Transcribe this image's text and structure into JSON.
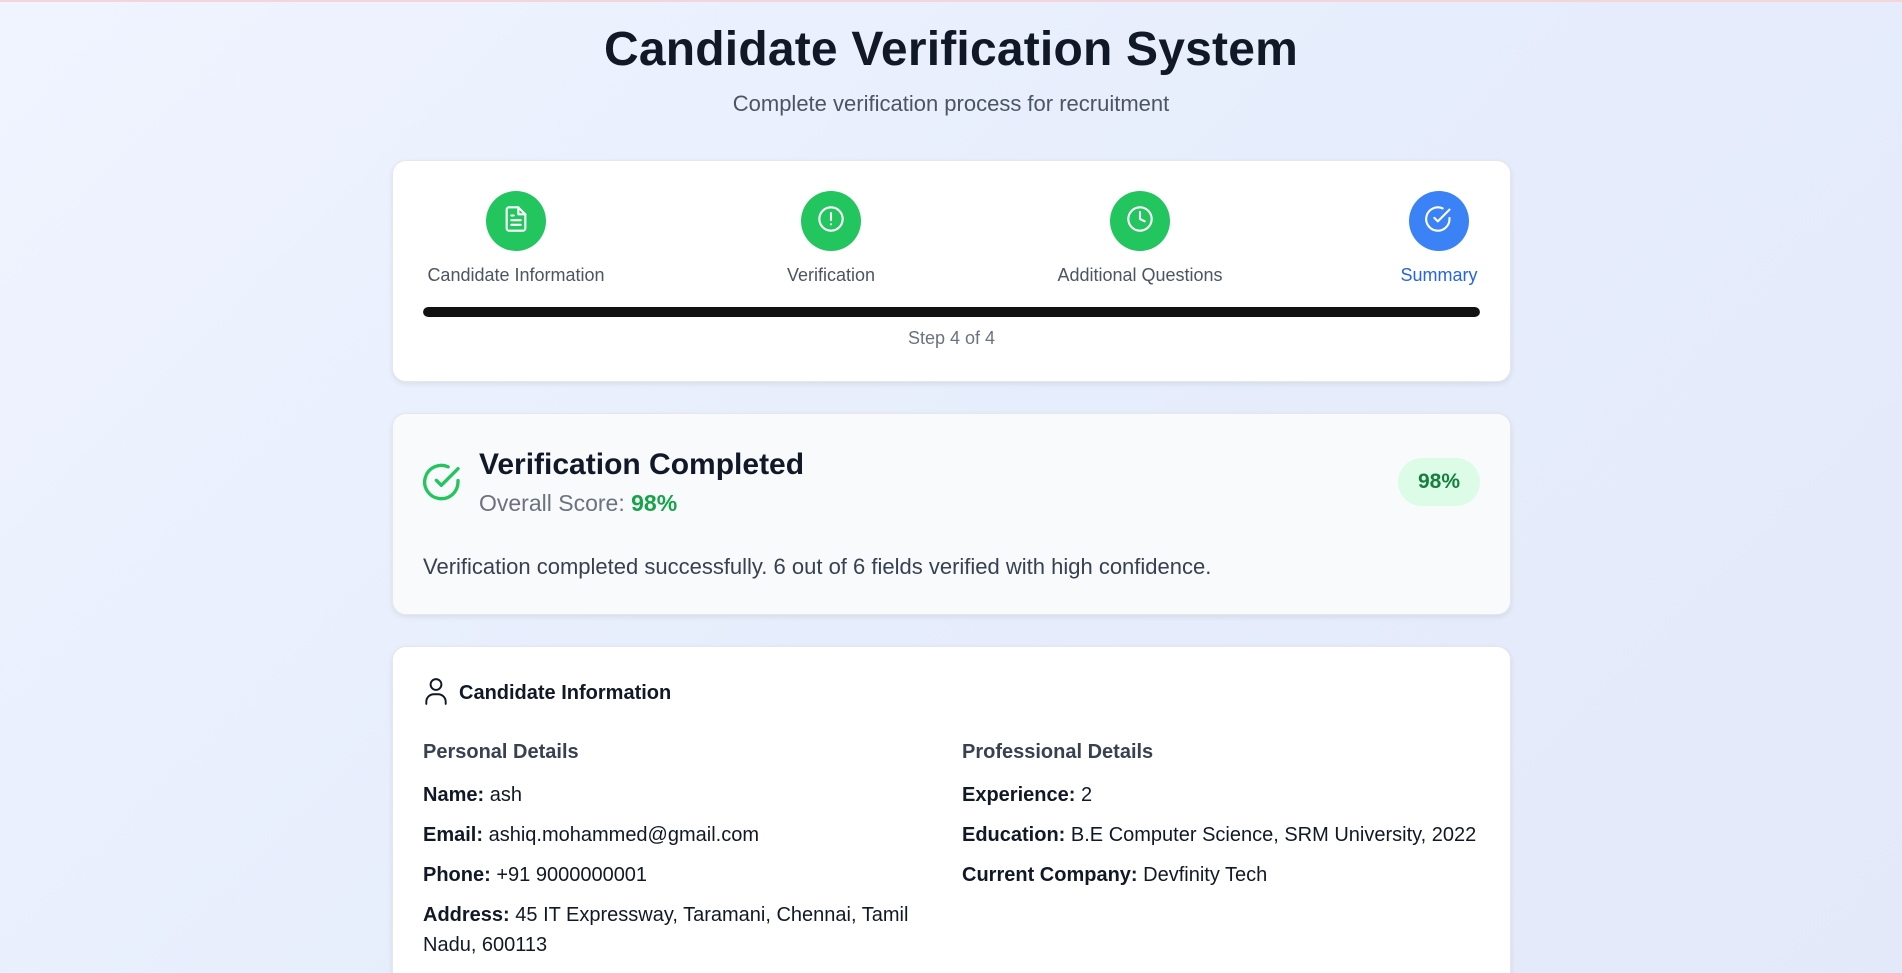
{
  "header": {
    "title": "Candidate Verification System",
    "subtitle": "Complete verification process for recruitment"
  },
  "stepper": {
    "steps": [
      {
        "label": "Candidate Information",
        "icon": "document-icon",
        "status": "completed"
      },
      {
        "label": "Verification",
        "icon": "alert-circle-icon",
        "status": "completed"
      },
      {
        "label": "Additional Questions",
        "icon": "clock-icon",
        "status": "completed"
      },
      {
        "label": "Summary",
        "icon": "check-circle-icon",
        "status": "active"
      }
    ],
    "progress_fraction": 1.0,
    "step_text": "Step 4 of 4"
  },
  "summary": {
    "title": "Verification Completed",
    "score_label": "Overall Score:",
    "score_value": "98%",
    "badge": "98%",
    "message": "Verification completed successfully. 6 out of 6 fields verified with high confidence."
  },
  "candidate": {
    "title": "Candidate Information",
    "personal": {
      "heading": "Personal Details",
      "fields": [
        {
          "label": "Name:",
          "value": "ash"
        },
        {
          "label": "Email:",
          "value": "ashiq.mohammed@gmail.com"
        },
        {
          "label": "Phone:",
          "value": "+91 9000000001"
        },
        {
          "label": "Address:",
          "value": "45 IT Expressway, Taramani, Chennai, Tamil Nadu, 600113"
        }
      ]
    },
    "professional": {
      "heading": "Professional Details",
      "fields": [
        {
          "label": "Experience:",
          "value": "2"
        },
        {
          "label": "Education:",
          "value": "B.E Computer Science, SRM University, 2022"
        },
        {
          "label": "Current Company:",
          "value": "Devfinity Tech"
        }
      ]
    }
  },
  "colors": {
    "step_completed": "#22c55e",
    "step_active": "#3b82f6",
    "score_green": "#16a34a",
    "progress_fill": "#111111"
  }
}
